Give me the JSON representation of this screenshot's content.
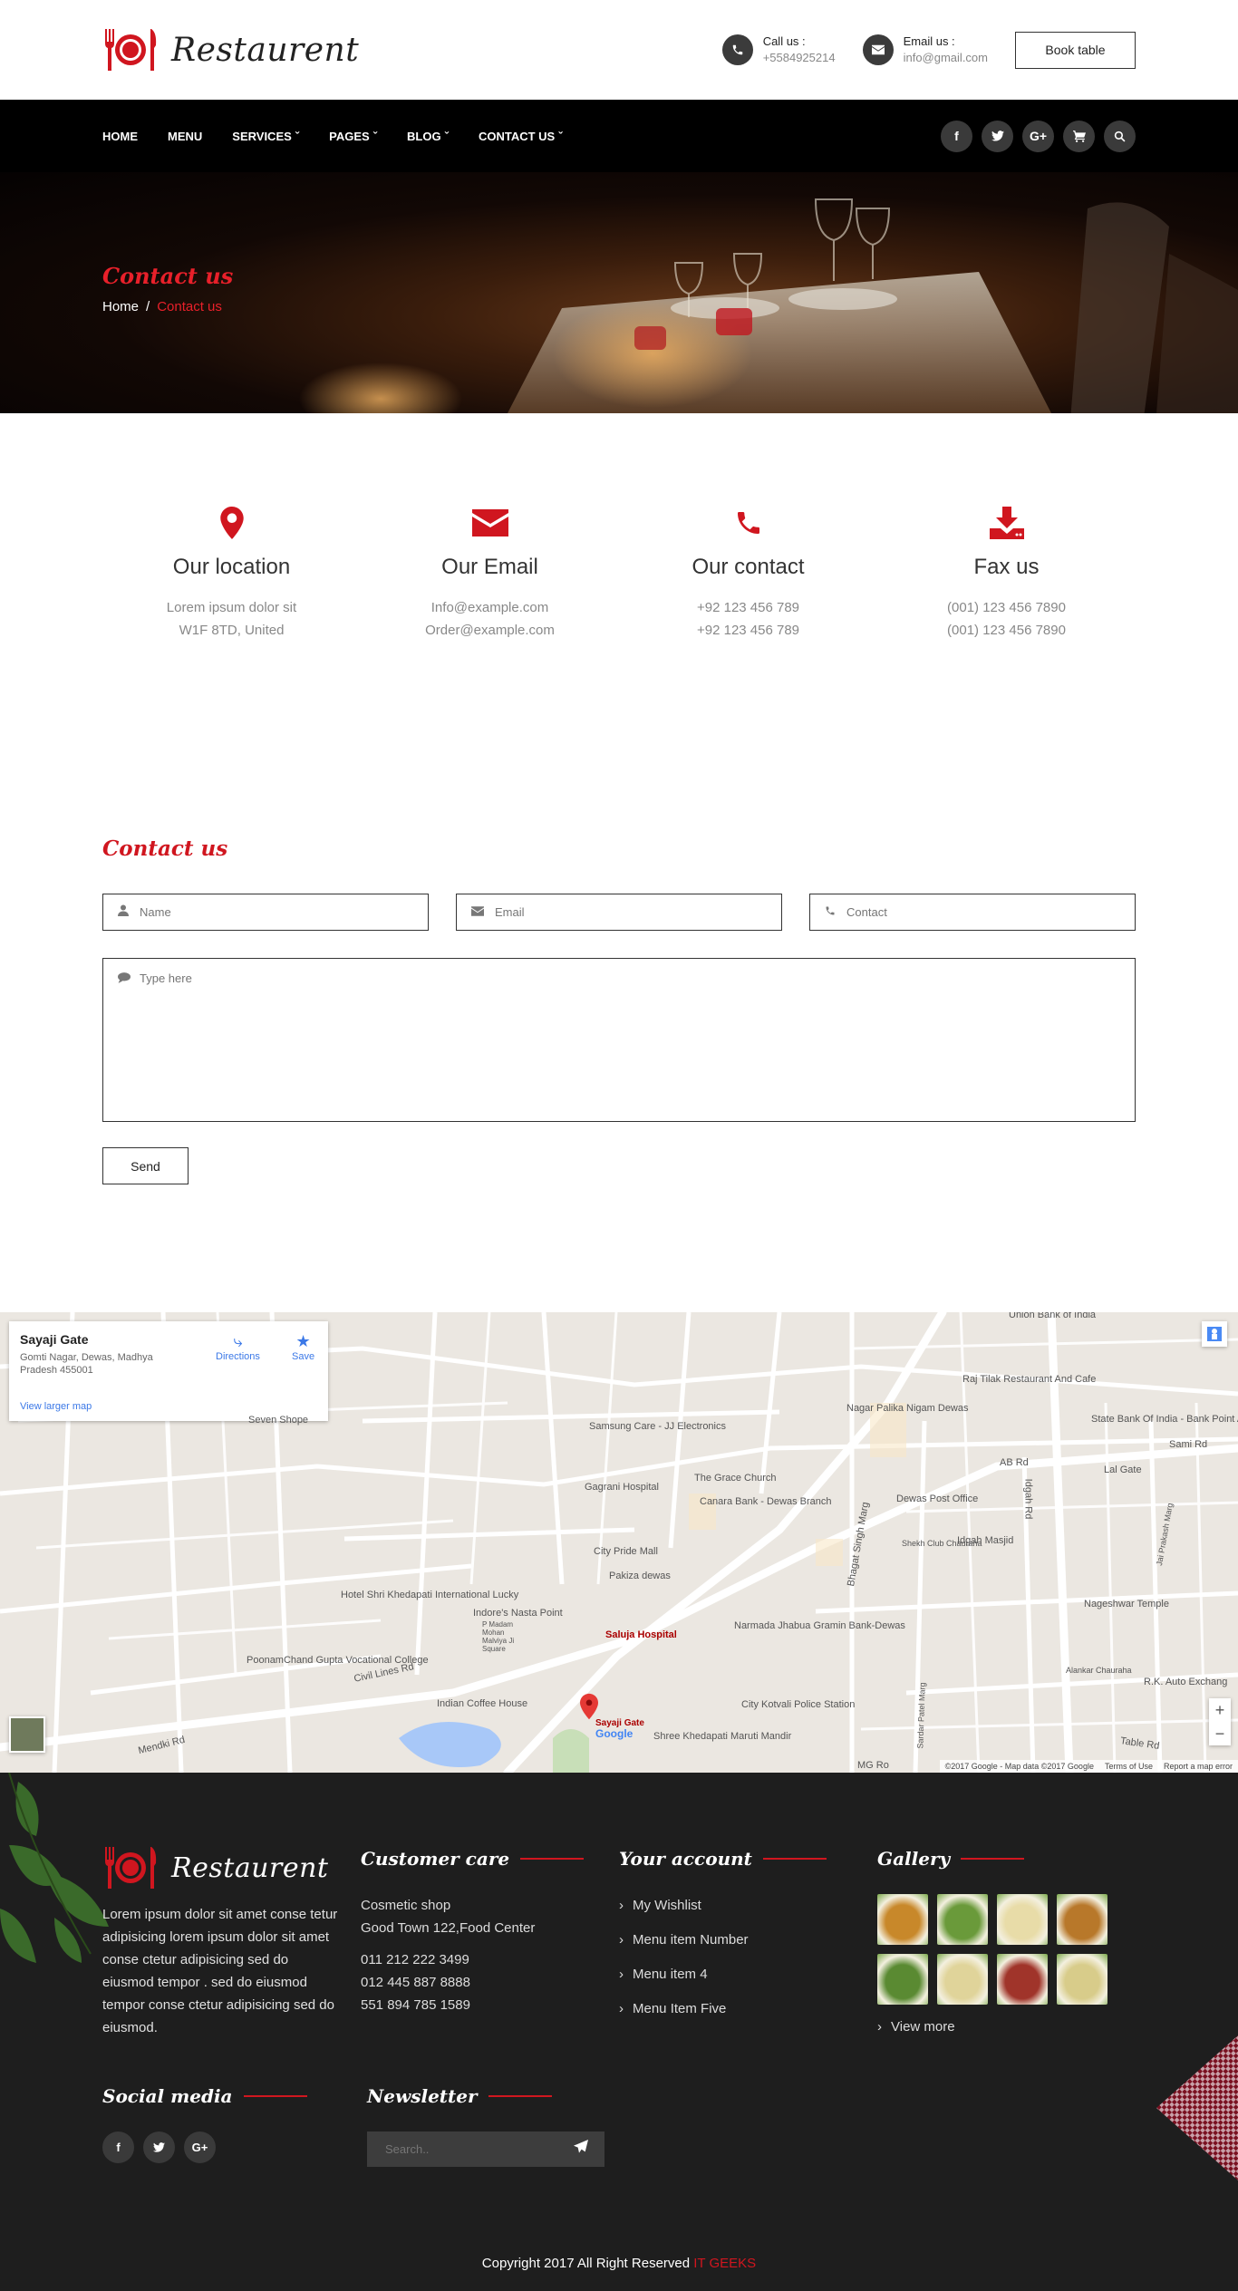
{
  "header": {
    "logo_text": "Restaurent",
    "call_label": "Call us :",
    "call_value": "+5584925214",
    "email_label": "Email us :",
    "email_value": "info@gmail.com",
    "book_button": "Book table"
  },
  "nav": {
    "items": [
      {
        "label": "HOME",
        "dropdown": false
      },
      {
        "label": "MENU",
        "dropdown": false
      },
      {
        "label": "SERVICES",
        "dropdown": true
      },
      {
        "label": "PAGES",
        "dropdown": true
      },
      {
        "label": "BLOG",
        "dropdown": true
      },
      {
        "label": "CONTACT US",
        "dropdown": true
      }
    ],
    "icons": [
      "facebook-icon",
      "twitter-icon",
      "google-plus-icon",
      "cart-icon",
      "search-icon"
    ]
  },
  "hero": {
    "title": "Contact us",
    "breadcrumb_home": "Home",
    "breadcrumb_sep": "/",
    "breadcrumb_current": "Contact us"
  },
  "info": [
    {
      "icon": "map-marker-icon",
      "title": "Our location",
      "line1": "Lorem ipsum dolor sit",
      "line2": "W1F 8TD, United"
    },
    {
      "icon": "envelope-icon",
      "title": "Our Email",
      "line1": "Info@example.com",
      "line2": "Order@example.com"
    },
    {
      "icon": "phone-icon",
      "title": "Our contact",
      "line1": "+92 123 456 789",
      "line2": "+92 123 456 789"
    },
    {
      "icon": "download-icon",
      "title": "Fax us",
      "line1": "(001) 123 456 7890",
      "line2": "(001) 123 456 7890"
    }
  ],
  "form": {
    "title": "Contact us",
    "name_placeholder": "Name",
    "email_placeholder": "Email",
    "contact_placeholder": "Contact",
    "message_placeholder": "Type here",
    "send_button": "Send"
  },
  "map": {
    "place": "Sayaji Gate",
    "address": "Gomti Nagar, Dewas, Madhya Pradesh 455001",
    "directions": "Directions",
    "save": "Save",
    "larger_map": "View larger map",
    "marker_label": "Sayaji Gate",
    "labels": [
      "Union Bank of India",
      "Raj Tilak Restaurant And Cafe",
      "Seven Shope",
      "Nagar Palika Nigam Dewas",
      "State Bank Of India - Bank Point AB Road",
      "Samsung Care - JJ Electronics",
      "Gagrani Hospital",
      "The Grace Church",
      "AB Rd",
      "Lal Gate",
      "Canara Bank - Dewas Branch",
      "Dewas Post Office",
      "City Pride Mall",
      "Idgah Masjid",
      "Shekh Club Chauraha",
      "Pakiza dewas",
      "Hotel Shri Khedapati International Lucky",
      "Indore's Nasta Point",
      "Nageshwar Temple",
      "Saluja Hospital",
      "Narmada Jhabua Gramin Bank-Dewas",
      "PoonamChand Gupta Vocational College",
      "Civil Lines Rd",
      "Alankar Chauraha",
      "R.K. Auto Exchang",
      "Indian Coffee House",
      "City Kotvali Police Station",
      "Shree Khedapati Maruti Mandir",
      "Mendki Rd",
      "Table Rd",
      "Idgah Rd",
      "Bhagat Singh Marg",
      "Sardar Patel Marg",
      "Jai Prakash Marg",
      "P Madam Mohan Malviya Ji Square",
      "Sami Rd",
      "MG Ro"
    ],
    "footer_data": "©2017 Google - Map data ©2017 Google",
    "footer_terms": "Terms of Use",
    "footer_report": "Report a map error",
    "google": "Google"
  },
  "footer": {
    "logo_text": "Restaurent",
    "about": "Lorem ipsum dolor sit amet conse tetur adipisicing lorem ipsum dolor sit amet conse ctetur adipisicing sed do eiusmod tempor . sed do eiusmod tempor conse ctetur adipisicing sed do eiusmod.",
    "customer_care_title": "Customer care",
    "shop_name": "Cosmetic shop",
    "shop_address": "Good Town 122,Food Center",
    "phones": [
      "011 212 222 3499",
      "012 445 887 8888",
      "551 894 785 1589"
    ],
    "account_title": "Your account",
    "account_links": [
      "My Wishlist",
      "Menu item Number",
      "Menu item 4",
      "Menu Item Five"
    ],
    "gallery_title": "Gallery",
    "gallery_colors": [
      "#c8882a",
      "#6a9a3a",
      "#e8dca8",
      "#b8782a",
      "#5a8a32",
      "#e0d49a",
      "#a0342a",
      "#d8cc8a"
    ],
    "view_more": "View more",
    "social_title": "Social media",
    "newsletter_title": "Newsletter",
    "newsletter_placeholder": "Search..",
    "copyright": "Copyright 2017 All Right Reserved",
    "copyright_brand": "IT GEEKS"
  },
  "colors": {
    "accent": "#d0161f",
    "dark": "#000000",
    "footer_bg": "#1e1e1e"
  }
}
